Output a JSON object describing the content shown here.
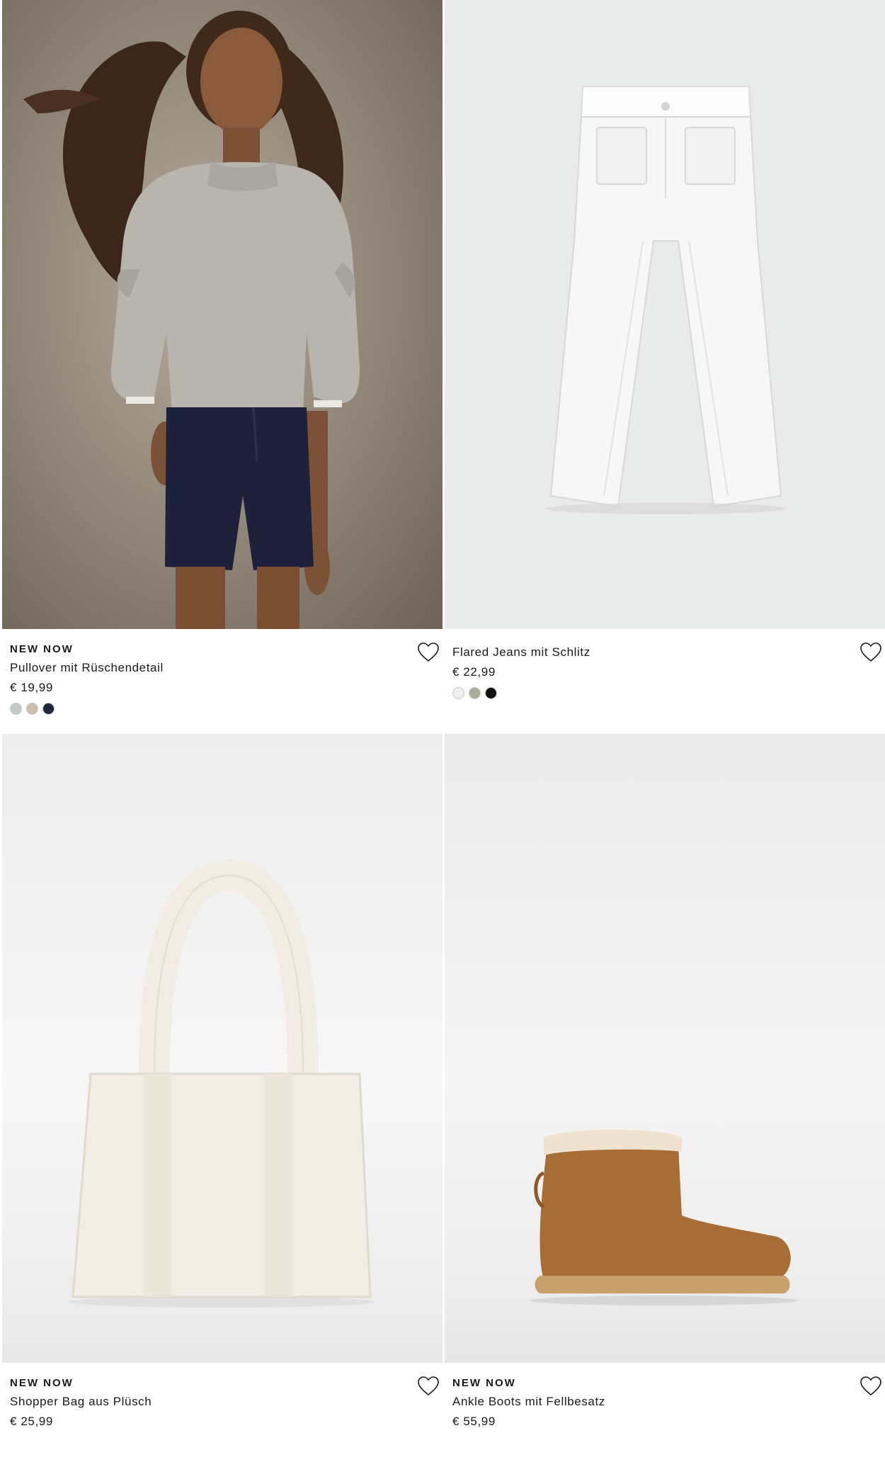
{
  "products": [
    {
      "tag": "NEW NOW",
      "name": "Pullover mit Rüschendetail",
      "price": "€ 19,99",
      "colors": [
        "#c4c8c7",
        "#cbbfa9",
        "#1f2838"
      ]
    },
    {
      "tag": "",
      "name": "Flared Jeans mit Schlitz",
      "price": "€ 22,99",
      "colors": [
        "#eeeeee",
        "#a9ae98",
        "#111111"
      ]
    },
    {
      "tag": "NEW NOW",
      "name": "Shopper Bag aus Plüsch",
      "price": "€ 25,99",
      "colors": []
    },
    {
      "tag": "NEW NOW",
      "name": "Ankle Boots mit Fellbesatz",
      "price": "€ 55,99",
      "colors": []
    }
  ],
  "icons": {
    "favorite": "heart-outline-icon"
  }
}
